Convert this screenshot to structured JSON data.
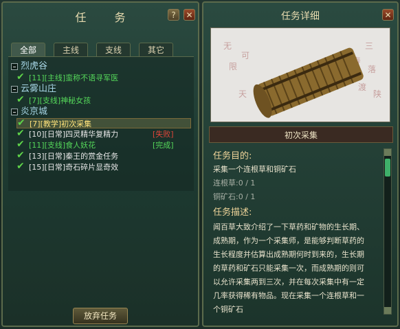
{
  "left": {
    "title": "任 务",
    "help": "?",
    "close": "✕",
    "tabs": [
      "全部",
      "主线",
      "支线",
      "其它"
    ],
    "categories": [
      {
        "name": "烈虎谷",
        "quests": [
          {
            "tag": "[11]",
            "text": "[主线]蛮称不语寻军医",
            "color": "#55d85a",
            "status": "",
            "status_color": ""
          }
        ]
      },
      {
        "name": "云雾山庄",
        "quests": [
          {
            "tag": "[7]",
            "text": "[支线]神秘女孩",
            "color": "#55d85a",
            "status": "",
            "status_color": ""
          }
        ]
      },
      {
        "name": "炎京城",
        "quests": [
          {
            "tag": "[7]",
            "text": "[教学]初次采集",
            "color": "#ffe27a",
            "status": "",
            "status_color": ""
          },
          {
            "tag": "[10]",
            "text": "[日常]四灵精华复精力",
            "color": "#e6e6e6",
            "status": "[失败]",
            "status_color": "#e0453a"
          },
          {
            "tag": "[11]",
            "text": "[支线]食人妖花",
            "color": "#55d85a",
            "status": "[完成]",
            "status_color": "#55d85a"
          },
          {
            "tag": "[13]",
            "text": "[日常]秦王的赏金任务",
            "color": "#e6e6e6",
            "status": "",
            "status_color": ""
          },
          {
            "tag": "[15]",
            "text": "[日常]奇石碎片显奇效",
            "color": "#e6e6e6",
            "status": "",
            "status_color": ""
          }
        ]
      }
    ],
    "abandon": "放弃任务"
  },
  "right": {
    "title": "任务详细",
    "close": "✕",
    "quest_name": "初次采集",
    "goal_header": "任务目的:",
    "goal": "采集一个连根草和铜矿石",
    "items": [
      {
        "name": "连根草",
        "count": ":0 / 1"
      },
      {
        "name": "铜矿石",
        "count": ":0 / 1"
      }
    ],
    "desc_header": "任务描述:",
    "desc_lines": [
      "闻百草大致介绍了一下草药和矿物的生长期、",
      "成熟期，作为一个采集师，是能够判断草药的",
      "生长程度并估算出成熟期何时到来的，生长期",
      "的草药和矿石只能采集一次，而成熟期的则可",
      "以允许采集两到三次，并在每次采集中有一定",
      "几率获得稀有物品。现在采集一个连根草和一",
      "个铜矿石"
    ]
  },
  "colors": {
    "check": "#5fd44a",
    "category": "#a7d6e6",
    "section": "#f0d59a"
  }
}
